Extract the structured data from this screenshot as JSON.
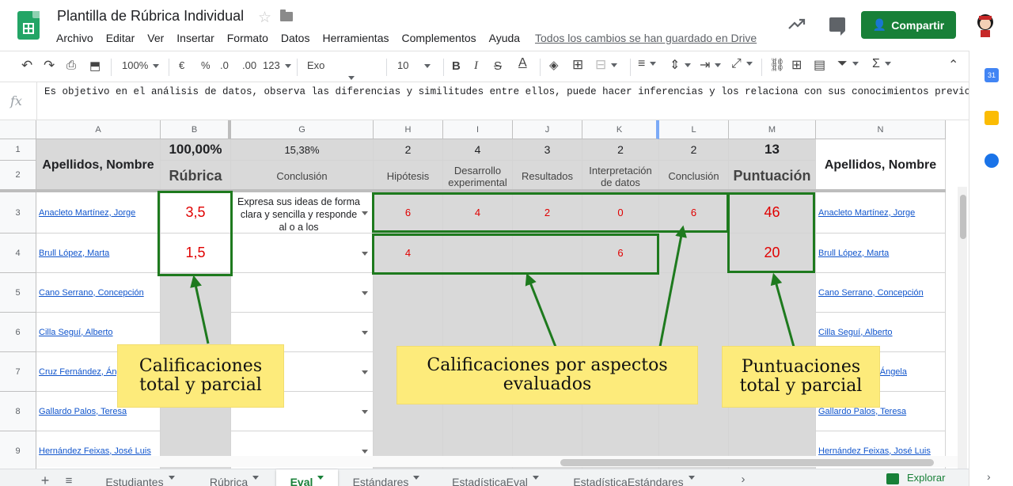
{
  "header": {
    "title": "Plantilla de Rúbrica Individual",
    "menu": [
      "Archivo",
      "Editar",
      "Ver",
      "Insertar",
      "Formato",
      "Datos",
      "Herramientas",
      "Complementos",
      "Ayuda"
    ],
    "save_status": "Todos los cambios se han guardado en Drive",
    "share_label": "Compartir"
  },
  "toolbar": {
    "zoom": "100%",
    "currency": "€",
    "percent": "%",
    "decimal_less": ".0",
    "decimal_more": ".00",
    "number_format": "123",
    "font": "Exo",
    "font_size": "10",
    "bold": "B",
    "italic": "I",
    "strike": "S",
    "text_color": "A",
    "sum": "Σ"
  },
  "formula_bar": {
    "fx": "fx",
    "text": "Es objetivo en el análisis de datos, observa las diferencias y similitudes entre ellos, puede hacer inferencias y los relaciona con sus conocimientos previos"
  },
  "columns": [
    "A",
    "B",
    "G",
    "H",
    "I",
    "J",
    "K",
    "L",
    "M",
    "N"
  ],
  "rows": [
    "1",
    "2",
    "3",
    "4",
    "5",
    "6",
    "7",
    "8",
    "9"
  ],
  "sheet_header": {
    "name_col": "Apellidos, Nombre",
    "b_top": "100,00%",
    "b_label": "Rúbrica",
    "g_top": "15,38%",
    "g_label": "Conclusión",
    "h_top": "2",
    "h_label": "Hipótesis",
    "i_top": "4",
    "i_label_1": "Desarrollo",
    "i_label_2": "experimental",
    "j_top": "3",
    "j_label": "Resultados",
    "k_top": "2",
    "k_label_1": "Interpretación",
    "k_label_2": "de datos",
    "l_top": "2",
    "l_label": "Conclusión",
    "m_top": "13",
    "m_label": "Puntuación",
    "n_label": "Apellidos, Nombre"
  },
  "students": [
    {
      "name": "Anacleto Martínez, Jorge",
      "rubrica": "3,5",
      "conclusion": "Expresa sus ideas de forma clara y sencilla y responde al o a los",
      "h": "6",
      "i": "4",
      "j": "2",
      "k": "0",
      "l": "6",
      "m": "46",
      "name_right": "Anacleto Martínez, Jorge"
    },
    {
      "name": "Brull López, Marta",
      "rubrica": "1,5",
      "conclusion": "",
      "h": "4",
      "i": "",
      "j": "",
      "k": "6",
      "l": "",
      "m": "20",
      "name_right": "Brull López, Marta"
    },
    {
      "name": "Cano Serrano, Concepción",
      "name_right": "Cano Serrano, Concepción"
    },
    {
      "name": "Cilla Seguí, Alberto",
      "name_right": "Cilla Seguí, Alberto"
    },
    {
      "name": "Cruz Fernández, Ánge",
      "name_right": "Ángela"
    },
    {
      "name": "Gallardo Palos, Teresa",
      "name_right": "Gallardo Palos, Teresa"
    },
    {
      "name": "Hernández Feixas, José Luis",
      "name_right": "Hernández Feixas, José Luis"
    }
  ],
  "callouts": {
    "left_1": "Calificaciones",
    "left_2": "total y parcial",
    "center_1": "Calificaciones por aspectos",
    "center_2": "evaluados",
    "right_1": "Puntuaciones",
    "right_2": "total y parcial"
  },
  "tabs": {
    "add": "+",
    "items": [
      "Estudiantes",
      "Rúbrica",
      "Eval",
      "Estándares",
      "EstadísticaEval",
      "EstadísticaEstándares"
    ],
    "active": "Eval",
    "explore": "Explorar"
  },
  "colors": {
    "share_green": "#188038",
    "highlight_green": "#1e7a1e",
    "callout_yellow": "#fdeb7b",
    "score_red": "#e00000",
    "link_blue": "#1155cc"
  }
}
